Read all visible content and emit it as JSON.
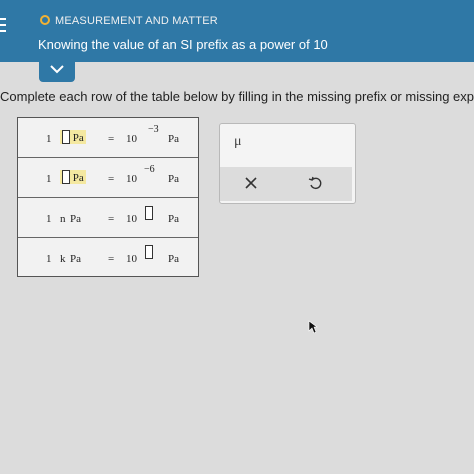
{
  "header": {
    "category": "MEASUREMENT AND MATTER",
    "topic": "Knowing the value of an SI prefix as a power of 10"
  },
  "instruction": "Complete each row of the table below by filling in the missing prefix or missing expon",
  "table": {
    "rows": [
      {
        "one": "1",
        "prefix": "",
        "unit": "Pa",
        "eq": "=",
        "base": "10",
        "exponent": "−3",
        "result_unit": "Pa"
      },
      {
        "one": "1",
        "prefix": "",
        "unit": "Pa",
        "eq": "=",
        "base": "10",
        "exponent": "−6",
        "result_unit": "Pa"
      },
      {
        "one": "1",
        "prefix": "n",
        "unit": "Pa",
        "eq": "=",
        "base": "10",
        "exponent": "",
        "result_unit": "Pa"
      },
      {
        "one": "1",
        "prefix": "k",
        "unit": "Pa",
        "eq": "=",
        "base": "10",
        "exponent": "",
        "result_unit": "Pa"
      }
    ]
  },
  "palette": {
    "symbol": "μ"
  },
  "icons": {
    "menu": "menu-icon",
    "chevron": "chevron-down-icon",
    "clear": "close-icon",
    "undo": "undo-icon",
    "cursor": "mouse-cursor-icon"
  },
  "colors": {
    "header_bg": "#2f78a6",
    "status_ring": "#f2b233",
    "highlight": "#f4e8a0"
  }
}
